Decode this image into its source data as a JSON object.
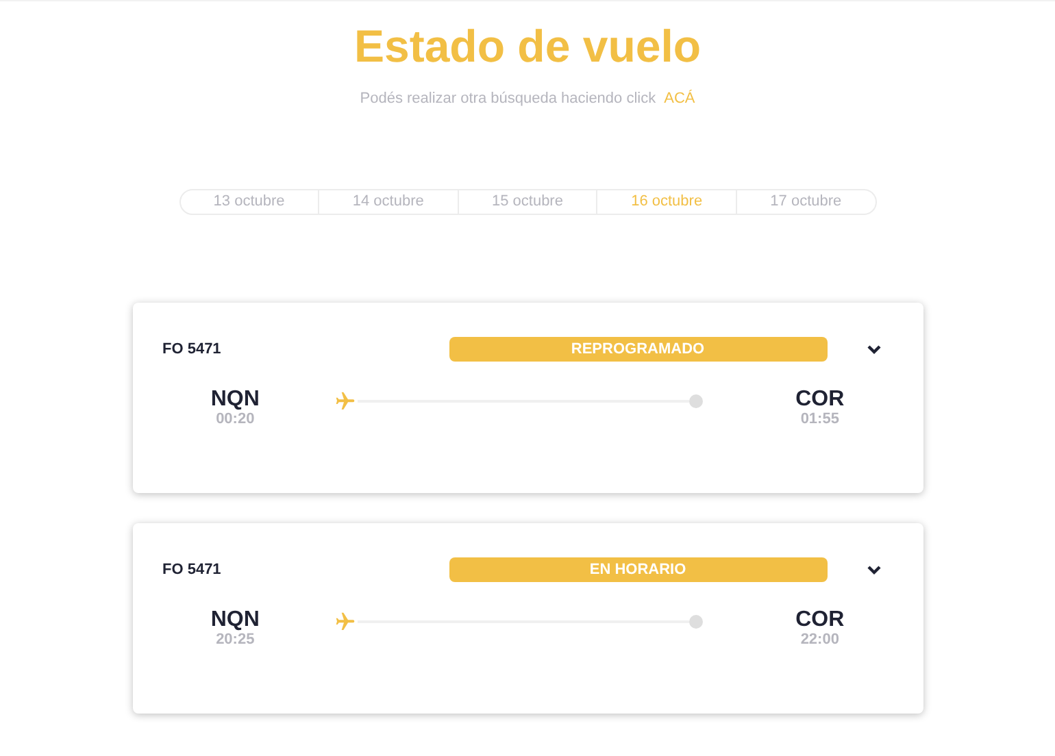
{
  "title": "Estado de vuelo",
  "subtitle": {
    "text": "Podés realizar otra búsqueda haciendo click",
    "link": "ACÁ"
  },
  "date_tabs": [
    {
      "label": "13 octubre",
      "selected": false
    },
    {
      "label": "14 octubre",
      "selected": false
    },
    {
      "label": "15 octubre",
      "selected": false
    },
    {
      "label": "16 octubre",
      "selected": true
    },
    {
      "label": "17 octubre",
      "selected": false
    }
  ],
  "flights": [
    {
      "flight_number": "FO 5471",
      "status": "REPROGRAMADO",
      "origin": {
        "code": "NQN",
        "time": "00:20"
      },
      "destination": {
        "code": "COR",
        "time": "01:55"
      }
    },
    {
      "flight_number": "FO 5471",
      "status": "EN HORARIO",
      "origin": {
        "code": "NQN",
        "time": "20:25"
      },
      "destination": {
        "code": "COR",
        "time": "22:00"
      }
    }
  ]
}
